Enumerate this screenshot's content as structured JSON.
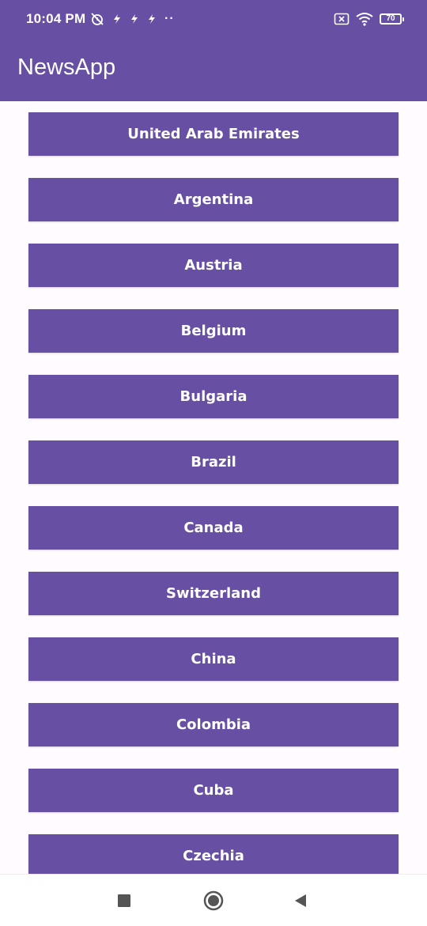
{
  "status_bar": {
    "time": "10:04 PM",
    "battery": "70",
    "left_icons": [
      "alarm-off-icon",
      "flash-icon",
      "flash-icon",
      "flash-icon",
      "more-dots-icon"
    ],
    "right_icons": [
      "sim-off-icon",
      "wifi-icon",
      "battery-icon"
    ],
    "more_dots": "··"
  },
  "app_bar": {
    "title": "NewsApp"
  },
  "countries": [
    "United Arab Emirates",
    "Argentina",
    "Austria",
    "Belgium",
    "Bulgaria",
    "Brazil",
    "Canada",
    "Switzerland",
    "China",
    "Colombia",
    "Cuba",
    "Czechia"
  ],
  "nav_bar": {
    "buttons": [
      "recents-icon",
      "home-icon",
      "back-icon"
    ]
  },
  "colors": {
    "primary": "#6750A4",
    "background": "#FFFBFE",
    "nav": "#FFFFFF"
  }
}
